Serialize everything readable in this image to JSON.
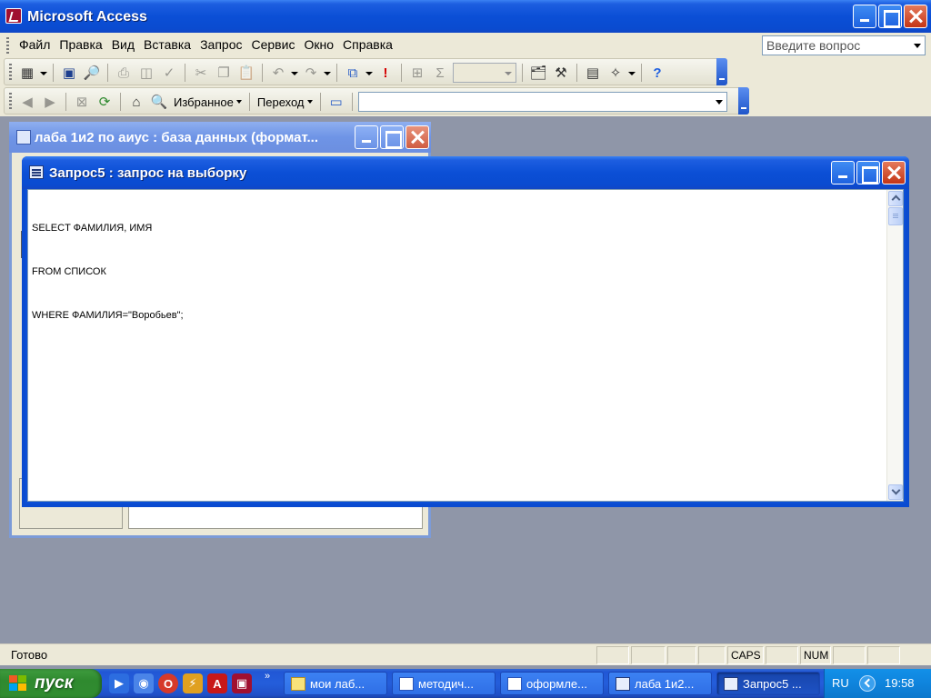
{
  "app": {
    "title": "Microsoft Access"
  },
  "menu": {
    "items": [
      "Файл",
      "Правка",
      "Вид",
      "Вставка",
      "Запрос",
      "Сервис",
      "Окно",
      "Справка"
    ],
    "help_placeholder": "Введите вопрос"
  },
  "web_toolbar": {
    "favorites_label": "Избранное",
    "goto_label": "Переход",
    "address_value": ""
  },
  "db_window": {
    "title": "лаба 1и2 по аиус : база данных (формат..."
  },
  "query_window": {
    "title": "Запрос5 : запрос на выборку",
    "sql_lines": [
      "SELECT ФАМИЛИЯ, ИМЯ",
      "FROM СПИСОК",
      "WHERE ФАМИЛИЯ=\"Воробьев\";"
    ]
  },
  "status_bar": {
    "text": "Готово",
    "caps": "CAPS",
    "num": "NUM"
  },
  "taskbar": {
    "start_label": "пуск",
    "tasks": [
      {
        "label": "мои лаб...",
        "icon": "folder-icon",
        "active": false
      },
      {
        "label": "методич...",
        "icon": "word-doc-icon",
        "active": false
      },
      {
        "label": "оформле...",
        "icon": "word-doc-icon",
        "active": false
      },
      {
        "label": "лаба 1и2...",
        "icon": "access-db-icon",
        "active": false
      },
      {
        "label": "Запрос5 ...",
        "icon": "access-query-icon",
        "active": true
      }
    ],
    "tray": {
      "language": "RU",
      "time": "19:58"
    }
  },
  "colors": {
    "xp_title_blue": "#0b4fd6",
    "inactive_title_blue": "#7c9bd8",
    "desktop_bg": "#8f96a8",
    "start_green": "#318c31"
  }
}
